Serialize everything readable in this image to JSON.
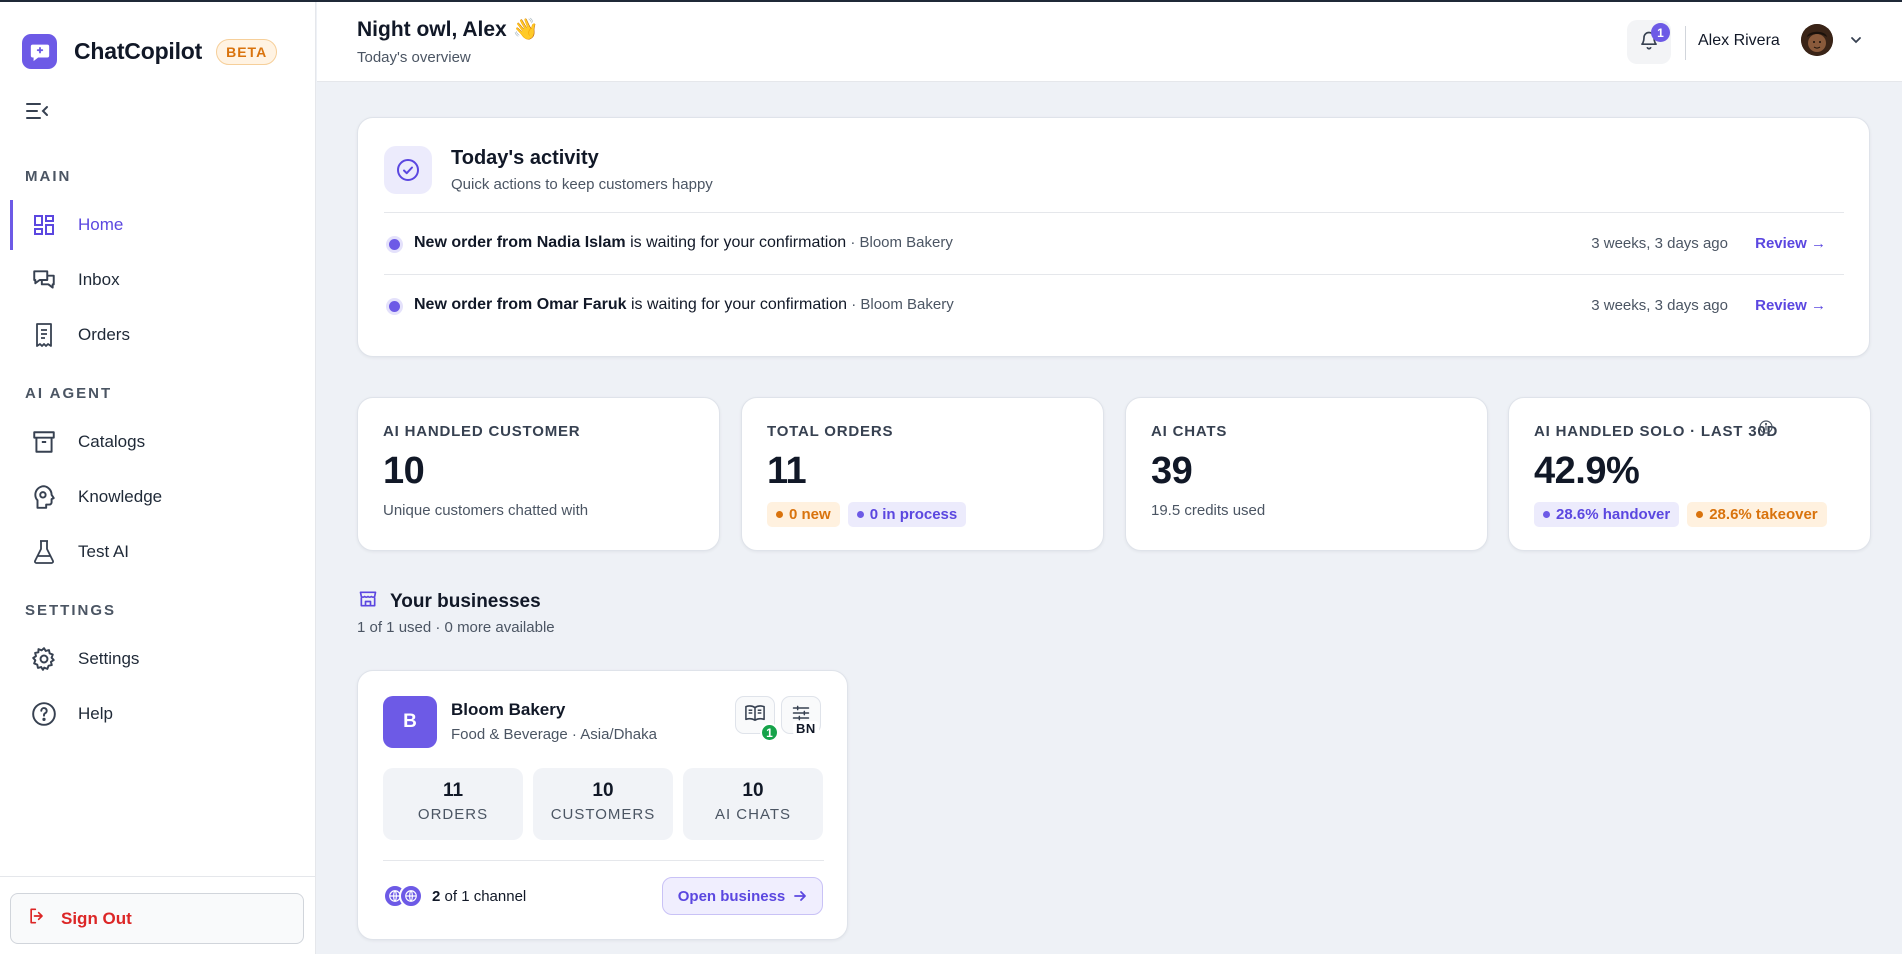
{
  "app": {
    "name": "ChatCopilot",
    "badge": "BETA"
  },
  "sidebar": {
    "sections": [
      {
        "label": "MAIN"
      },
      {
        "label": "AI AGENT"
      },
      {
        "label": "SETTINGS"
      }
    ],
    "items": [
      {
        "label": "Home",
        "icon": "dashboard-icon",
        "active": true
      },
      {
        "label": "Inbox",
        "icon": "chat-bubbles-icon"
      },
      {
        "label": "Orders",
        "icon": "receipt-icon"
      },
      {
        "label": "Catalogs",
        "icon": "archive-box-icon"
      },
      {
        "label": "Knowledge",
        "icon": "brain-head-icon"
      },
      {
        "label": "Test AI",
        "icon": "beaker-icon"
      },
      {
        "label": "Settings",
        "icon": "gear-icon"
      },
      {
        "label": "Help",
        "icon": "question-circle-icon"
      }
    ],
    "sign_out": "Sign Out"
  },
  "header": {
    "greeting": "Night owl, Alex 👋",
    "subtitle": "Today's overview",
    "notifications": "1",
    "user_name": "Alex Rivera"
  },
  "activity": {
    "title": "Today's activity",
    "subtitle": "Quick actions to keep customers happy",
    "rows": [
      {
        "bold": "New order from Nadia Islam",
        "text": " is waiting for your confirmation",
        "business": " · Bloom Bakery",
        "time": "3 weeks, 3 days ago",
        "action": "Review →"
      },
      {
        "bold": "New order from Omar Faruk",
        "text": " is waiting for your confirmation",
        "business": " · Bloom Bakery",
        "time": "3 weeks, 3 days ago",
        "action": "Review →"
      }
    ]
  },
  "stats": [
    {
      "label": "AI HANDLED CUSTOMER",
      "value": "10",
      "note": "Unique customers chatted with"
    },
    {
      "label": "TOTAL ORDERS",
      "value": "11",
      "pills": [
        "0 new",
        "0 in process"
      ]
    },
    {
      "label": "AI CHATS",
      "value": "39",
      "note": "19.5 credits used"
    },
    {
      "label": "AI HANDLED SOLO · LAST 30D",
      "value": "42.9%",
      "pills": [
        "28.6% handover",
        "28.6% takeover"
      ]
    }
  ],
  "businesses": {
    "title": "Your businesses",
    "subtitle": "1 of 1 used · 0 more available",
    "items": [
      {
        "initial": "B",
        "name": "Bloom Bakery",
        "meta": "Food & Beverage · Asia/Dhaka",
        "knowledge_count": "1",
        "language": "BN",
        "stats": [
          {
            "value": "11",
            "label": "ORDERS"
          },
          {
            "value": "10",
            "label": "CUSTOMERS"
          },
          {
            "value": "10",
            "label": "AI CHATS"
          }
        ],
        "channels_count": "2",
        "channels_text": " of 1 channel",
        "open_label": "Open business"
      }
    ]
  },
  "colors": {
    "accent": "#6d5ae6",
    "danger": "#dc2626",
    "warning": "#d9730d",
    "success": "#16a34a"
  }
}
